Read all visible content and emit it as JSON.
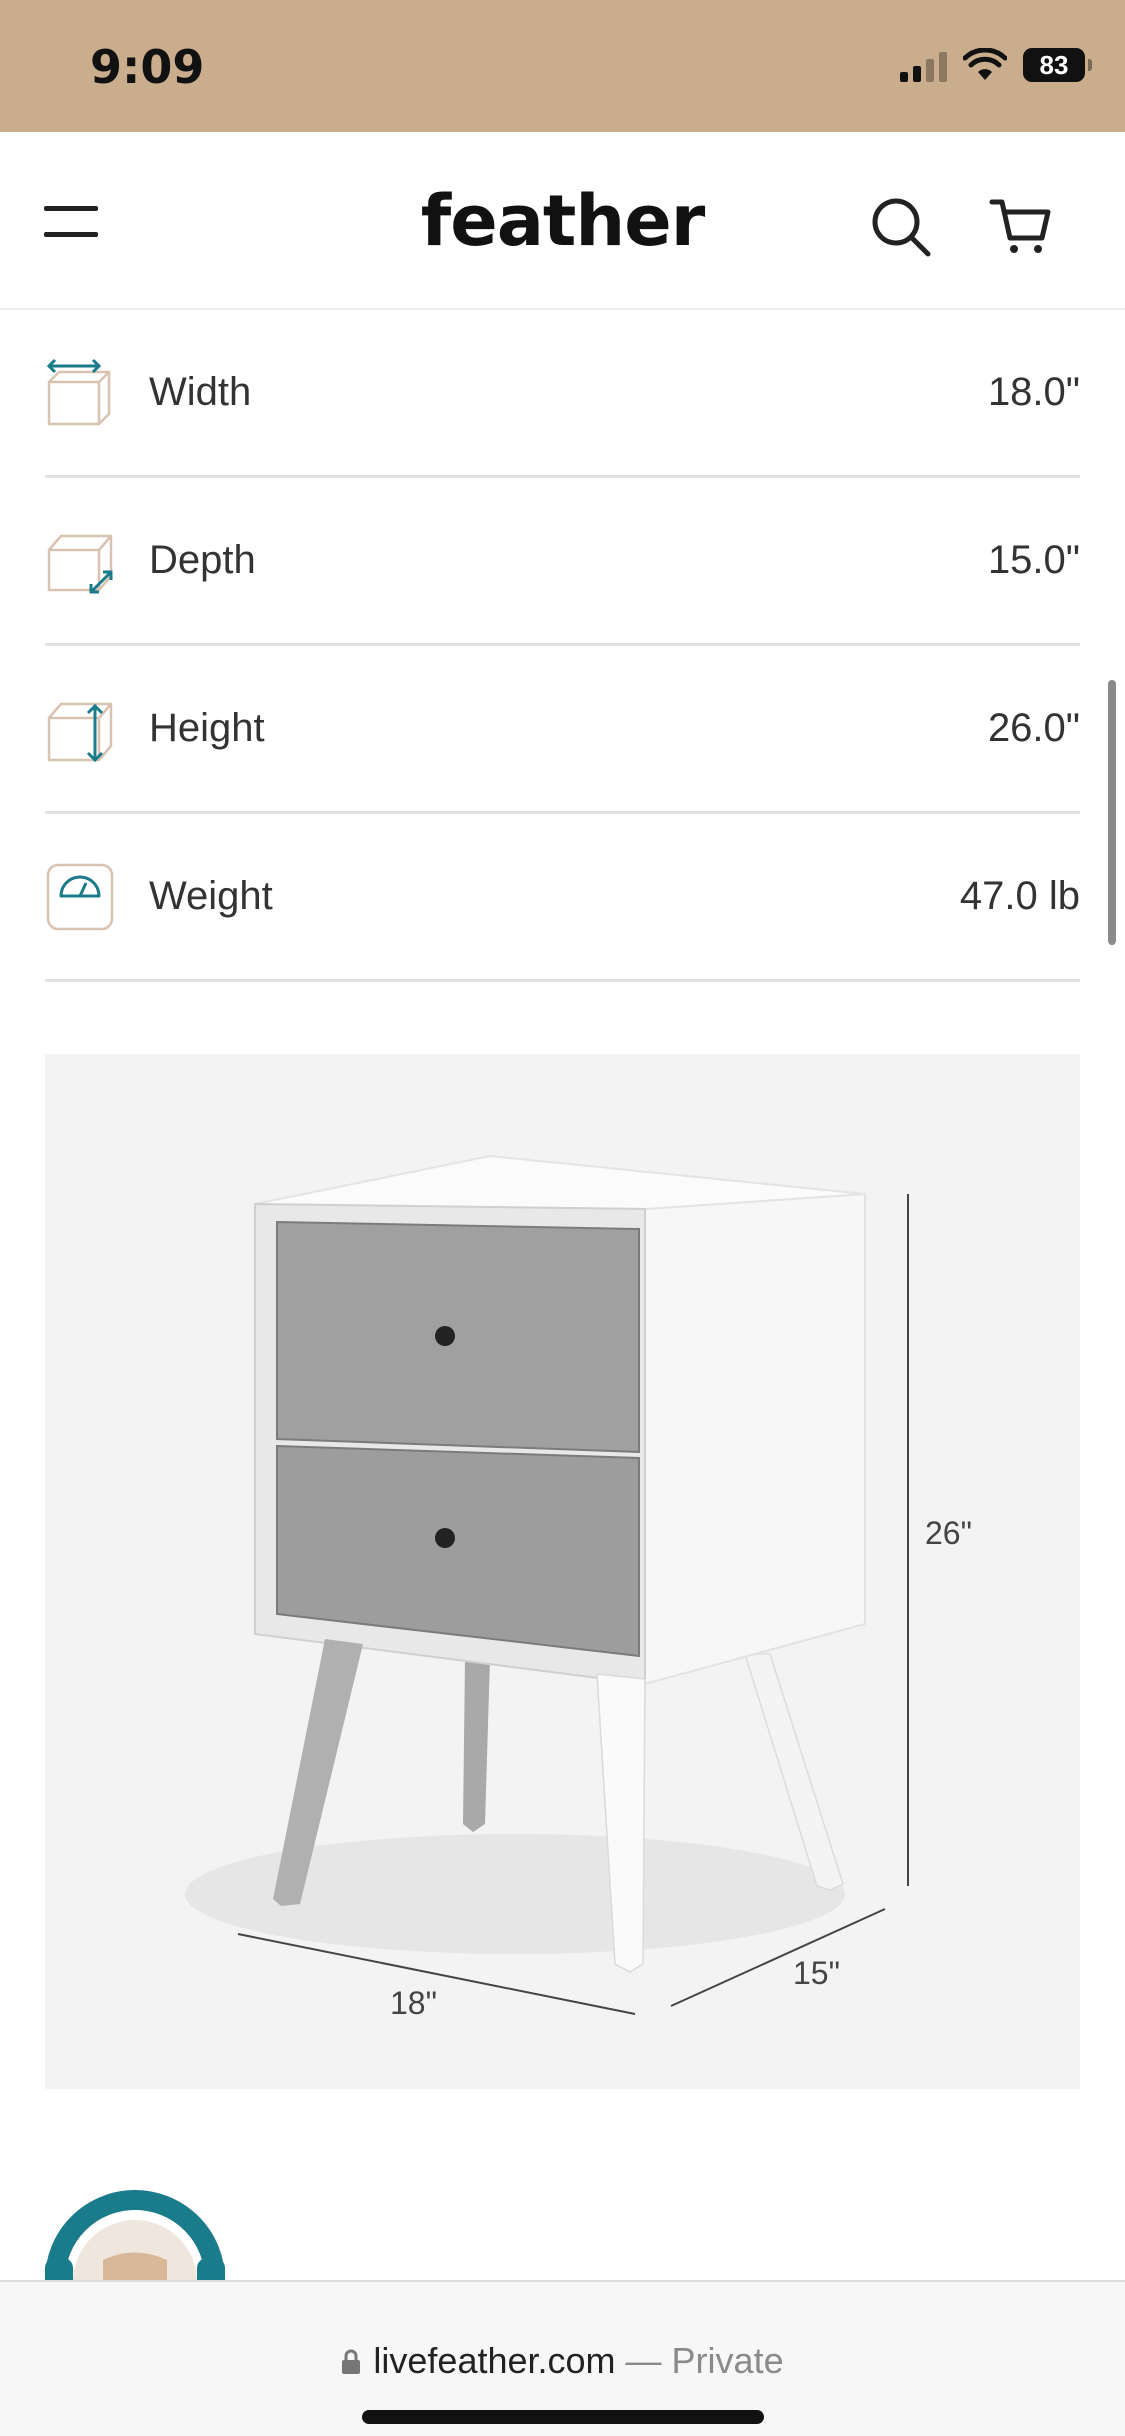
{
  "status_bar": {
    "time": "9:09",
    "battery": "83"
  },
  "header": {
    "logo": "feather",
    "icons": [
      "menu-icon",
      "search-icon",
      "cart-icon"
    ]
  },
  "specs": [
    {
      "icon": "width-icon",
      "label": "Width",
      "value": "18.0\""
    },
    {
      "icon": "depth-icon",
      "label": "Depth",
      "value": "15.0\""
    },
    {
      "icon": "height-icon",
      "label": "Height",
      "value": "26.0\""
    },
    {
      "icon": "weight-icon",
      "label": "Weight",
      "value": "47.0 lb"
    }
  ],
  "product_image": {
    "dimension_labels": {
      "height": "26\"",
      "width": "18\"",
      "depth": "15\""
    }
  },
  "browser_bar": {
    "domain": "livefeather.com",
    "suffix": "— Private"
  },
  "colors": {
    "status_bar": "#c9ad8c",
    "accent": "#1a7b8a",
    "icon_outline": "#d9c3b0",
    "divider": "#e2e2e2"
  }
}
